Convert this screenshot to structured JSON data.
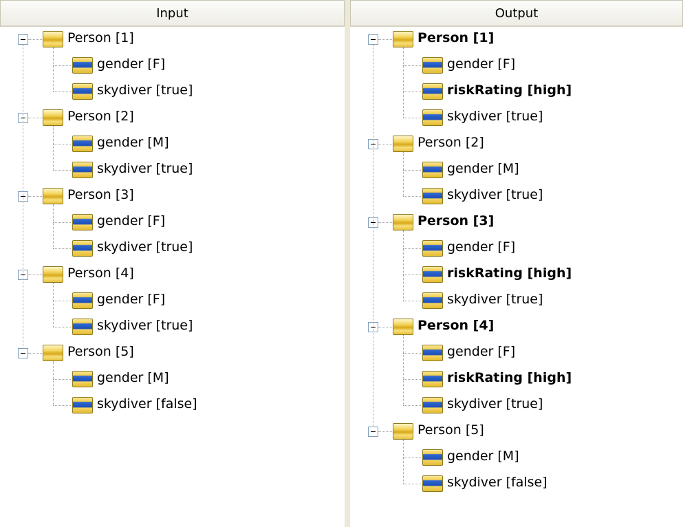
{
  "input": {
    "header": "Input",
    "persons": [
      {
        "label": "Person [1]",
        "props": [
          {
            "label": "gender [F]"
          },
          {
            "label": "skydiver [true]"
          }
        ]
      },
      {
        "label": "Person [2]",
        "props": [
          {
            "label": "gender [M]"
          },
          {
            "label": "skydiver [true]"
          }
        ]
      },
      {
        "label": "Person [3]",
        "props": [
          {
            "label": "gender [F]"
          },
          {
            "label": "skydiver [true]"
          }
        ]
      },
      {
        "label": "Person [4]",
        "props": [
          {
            "label": "gender [F]"
          },
          {
            "label": "skydiver [true]"
          }
        ]
      },
      {
        "label": "Person [5]",
        "props": [
          {
            "label": "gender [M]"
          },
          {
            "label": "skydiver [false]"
          }
        ]
      }
    ]
  },
  "output": {
    "header": "Output",
    "persons": [
      {
        "label": "Person [1]",
        "bold": true,
        "props": [
          {
            "label": "gender [F]"
          },
          {
            "label": "riskRating [high]",
            "bold": true
          },
          {
            "label": "skydiver [true]"
          }
        ]
      },
      {
        "label": "Person [2]",
        "props": [
          {
            "label": "gender [M]"
          },
          {
            "label": "skydiver [true]"
          }
        ]
      },
      {
        "label": "Person [3]",
        "bold": true,
        "props": [
          {
            "label": "gender [F]"
          },
          {
            "label": "riskRating [high]",
            "bold": true
          },
          {
            "label": "skydiver [true]"
          }
        ]
      },
      {
        "label": "Person [4]",
        "bold": true,
        "props": [
          {
            "label": "gender [F]"
          },
          {
            "label": "riskRating [high]",
            "bold": true
          },
          {
            "label": "skydiver [true]"
          }
        ]
      },
      {
        "label": "Person [5]",
        "props": [
          {
            "label": "gender [M]"
          },
          {
            "label": "skydiver [false]"
          }
        ]
      }
    ]
  }
}
